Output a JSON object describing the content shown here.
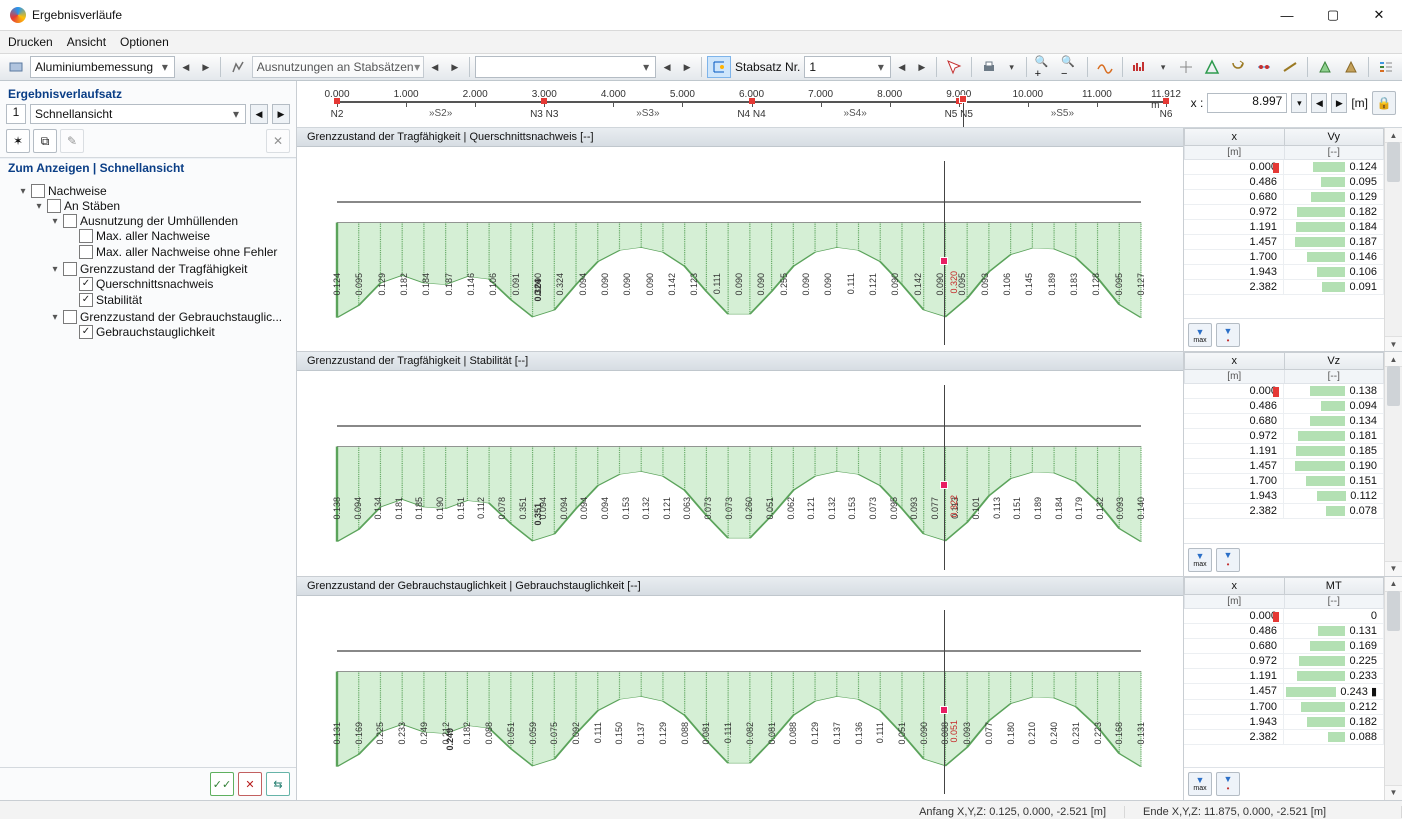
{
  "window": {
    "title": "Ergebnisverläufe"
  },
  "menu": {
    "items": [
      "Drucken",
      "Ansicht",
      "Optionen"
    ]
  },
  "toolbar": {
    "design_combo": "Aluminiumbemessung",
    "utiliz_combo": "Ausnutzungen an Stabsätzen",
    "set_label": "Stabsatz Nr.",
    "set_value": "1"
  },
  "sidebar": {
    "section_title": "Ergebnisverlaufsatz",
    "index": "1",
    "view_combo": "Schnellansicht",
    "tree_title": "Zum Anzeigen | Schnellansicht",
    "tree": {
      "nachweise": "Nachweise",
      "an_staeben": "An Stäben",
      "umhuellende": "Ausnutzung der Umhüllenden",
      "max_aller": "Max. aller Nachweise",
      "max_aller_ohne": "Max. aller Nachweise ohne Fehler",
      "gzt": "Grenzzustand der Tragfähigkeit",
      "qsn": "Querschnittsnachweis",
      "stab": "Stabilität",
      "gzg": "Grenzzustand der Gebrauchstauglic...",
      "gebr": "Gebrauchstauglichkeit"
    }
  },
  "ruler": {
    "ticks": [
      "0.000",
      "1.000",
      "2.000",
      "3.000",
      "4.000",
      "5.000",
      "6.000",
      "7.000",
      "8.000",
      "9.000",
      "10.000",
      "11.000",
      "11.912 m"
    ],
    "nodes": [
      {
        "pct": 0,
        "label": "N2"
      },
      {
        "pct": 25,
        "label": "N3  N3"
      },
      {
        "pct": 50,
        "label": "N4  N4"
      },
      {
        "pct": 75,
        "label": "N5  N5"
      },
      {
        "pct": 100,
        "label": "N6"
      }
    ],
    "spans": [
      {
        "pct": 12.5,
        "label": "»S2»"
      },
      {
        "pct": 37.5,
        "label": "»S3»"
      },
      {
        "pct": 62.5,
        "label": "»S4»"
      },
      {
        "pct": 87.5,
        "label": "»S5»"
      }
    ],
    "x_label": "x :",
    "x_value": "8.997",
    "x_unit": "[m]",
    "cursor_pct": 75.5
  },
  "panels": [
    {
      "title": "Grenzzustand der Tragfähigkeit | Querschnittsnachweis [--]",
      "max_value": "0.324",
      "max_pct": 25,
      "cursor_value": "0.320",
      "cursor_pct": 75.5,
      "labels": [
        "0.124",
        "0.095",
        "0.129",
        "0.182",
        "0.184",
        "0.187",
        "0.146",
        "0.106",
        "0.091",
        "0.090",
        "0.324",
        "0.094",
        "0.090",
        "0.090",
        "0.090",
        "0.142",
        "0.123",
        "0.111",
        "0.090",
        "0.090",
        "0.255",
        "0.090",
        "0.090",
        "0.111",
        "0.121",
        "0.090",
        "0.142",
        "0.090",
        "0.095",
        "0.093",
        "0.106",
        "0.145",
        "0.189",
        "0.183",
        "0.128",
        "0.095",
        "0.127"
      ],
      "data_head": [
        "x",
        "Vy"
      ],
      "data_sub": [
        "[m]",
        "[--]"
      ],
      "rows": [
        {
          "x": "0.000",
          "v": "0.124",
          "cursor": true,
          "bar": 32
        },
        {
          "x": "0.486",
          "v": "0.095",
          "bar": 24
        },
        {
          "x": "0.680",
          "v": "0.129",
          "bar": 34
        },
        {
          "x": "0.972",
          "v": "0.182",
          "bar": 48
        },
        {
          "x": "1.191",
          "v": "0.184",
          "bar": 49
        },
        {
          "x": "1.457",
          "v": "0.187",
          "bar": 50
        },
        {
          "x": "1.700",
          "v": "0.146",
          "bar": 38
        },
        {
          "x": "1.943",
          "v": "0.106",
          "bar": 28
        },
        {
          "x": "2.382",
          "v": "0.091",
          "bar": 23
        }
      ]
    },
    {
      "title": "Grenzzustand der Tragfähigkeit | Stabilität [--]",
      "max_value": "0.351",
      "max_pct": 25,
      "cursor_value": "0.322",
      "cursor_pct": 75.5,
      "labels": [
        "0.138",
        "0.094",
        "0.134",
        "0.181",
        "0.185",
        "0.190",
        "0.151",
        "0.112",
        "0.078",
        "0.351",
        "0.094",
        "0.094",
        "0.094",
        "0.094",
        "0.153",
        "0.132",
        "0.121",
        "0.063",
        "0.073",
        "0.073",
        "0.260",
        "0.051",
        "0.062",
        "0.121",
        "0.132",
        "0.153",
        "0.073",
        "0.095",
        "0.093",
        "0.077",
        "0.113",
        "0.101",
        "0.113",
        "0.151",
        "0.189",
        "0.184",
        "0.179",
        "0.132",
        "0.093",
        "0.140"
      ],
      "data_head": [
        "x",
        "Vz"
      ],
      "data_sub": [
        "[m]",
        "[--]"
      ],
      "rows": [
        {
          "x": "0.000",
          "v": "0.138",
          "cursor": true,
          "bar": 35
        },
        {
          "x": "0.486",
          "v": "0.094",
          "bar": 24
        },
        {
          "x": "0.680",
          "v": "0.134",
          "bar": 35
        },
        {
          "x": "0.972",
          "v": "0.181",
          "bar": 47
        },
        {
          "x": "1.191",
          "v": "0.185",
          "bar": 49
        },
        {
          "x": "1.457",
          "v": "0.190",
          "bar": 50
        },
        {
          "x": "1.700",
          "v": "0.151",
          "bar": 39
        },
        {
          "x": "1.943",
          "v": "0.112",
          "bar": 29
        },
        {
          "x": "2.382",
          "v": "0.078",
          "bar": 19
        }
      ]
    },
    {
      "title": "Grenzzustand der Gebrauchstauglichkeit | Gebrauchstauglichkeit [--]",
      "max_value": "0.249",
      "max_pct": 14,
      "cursor_value": "0.051",
      "cursor_pct": 75.5,
      "labels": [
        "0.131",
        "0.169",
        "0.225",
        "0.233",
        "0.249",
        "0.212",
        "0.182",
        "0.088",
        "0.051",
        "0.059",
        "0.075",
        "0.092",
        "0.111",
        "0.150",
        "0.137",
        "0.129",
        "0.088",
        "0.081",
        "0.111",
        "0.082",
        "0.081",
        "0.088",
        "0.129",
        "0.137",
        "0.136",
        "0.111",
        "0.051",
        "0.090",
        "0.088",
        "0.093",
        "0.077",
        "0.180",
        "0.210",
        "0.240",
        "0.231",
        "0.223",
        "0.168",
        "0.131"
      ],
      "data_head": [
        "x",
        "MT"
      ],
      "data_sub": [
        "[m]",
        "[--]"
      ],
      "rows": [
        {
          "x": "0.000",
          "v": "0",
          "cursor": true,
          "bar": 0
        },
        {
          "x": "0.486",
          "v": "0.131",
          "bar": 27
        },
        {
          "x": "0.680",
          "v": "0.169",
          "bar": 35
        },
        {
          "x": "0.972",
          "v": "0.225",
          "bar": 46
        },
        {
          "x": "1.191",
          "v": "0.233",
          "bar": 48
        },
        {
          "x": "1.457",
          "v": "0.243 ▮",
          "bar": 50
        },
        {
          "x": "1.700",
          "v": "0.212",
          "bar": 44
        },
        {
          "x": "1.943",
          "v": "0.182",
          "bar": 38
        },
        {
          "x": "2.382",
          "v": "0.088",
          "bar": 17
        }
      ]
    }
  ],
  "chart_data": [
    {
      "type": "area",
      "title": "Querschnittsnachweis",
      "x_range": [
        0,
        11.912
      ],
      "y_range": [
        0,
        0.35
      ],
      "series": [
        {
          "name": "Vy",
          "peaks": [
            {
              "x": 2.978,
              "y": 0.324
            },
            {
              "x": 8.997,
              "y": 0.32
            }
          ],
          "endpoints": [
            0.124,
            0.127
          ]
        }
      ]
    },
    {
      "type": "area",
      "title": "Stabilität",
      "x_range": [
        0,
        11.912
      ],
      "y_range": [
        0,
        0.36
      ],
      "series": [
        {
          "name": "Vz",
          "peaks": [
            {
              "x": 2.978,
              "y": 0.351
            },
            {
              "x": 8.997,
              "y": 0.322
            }
          ],
          "endpoints": [
            0.138,
            0.14
          ]
        }
      ]
    },
    {
      "type": "area",
      "title": "Gebrauchstauglichkeit",
      "x_range": [
        0,
        11.912
      ],
      "y_range": [
        0,
        0.26
      ],
      "series": [
        {
          "name": "MT",
          "peaks": [
            {
              "x": 1.7,
              "y": 0.249
            },
            {
              "x": 10.2,
              "y": 0.24
            }
          ],
          "endpoints": [
            0,
            0
          ]
        }
      ]
    }
  ],
  "status": {
    "anfang": "Anfang X,Y,Z: 0.125, 0.000, -2.521 [m]",
    "ende": "Ende X,Y,Z: 11.875, 0.000, -2.521 [m]"
  }
}
